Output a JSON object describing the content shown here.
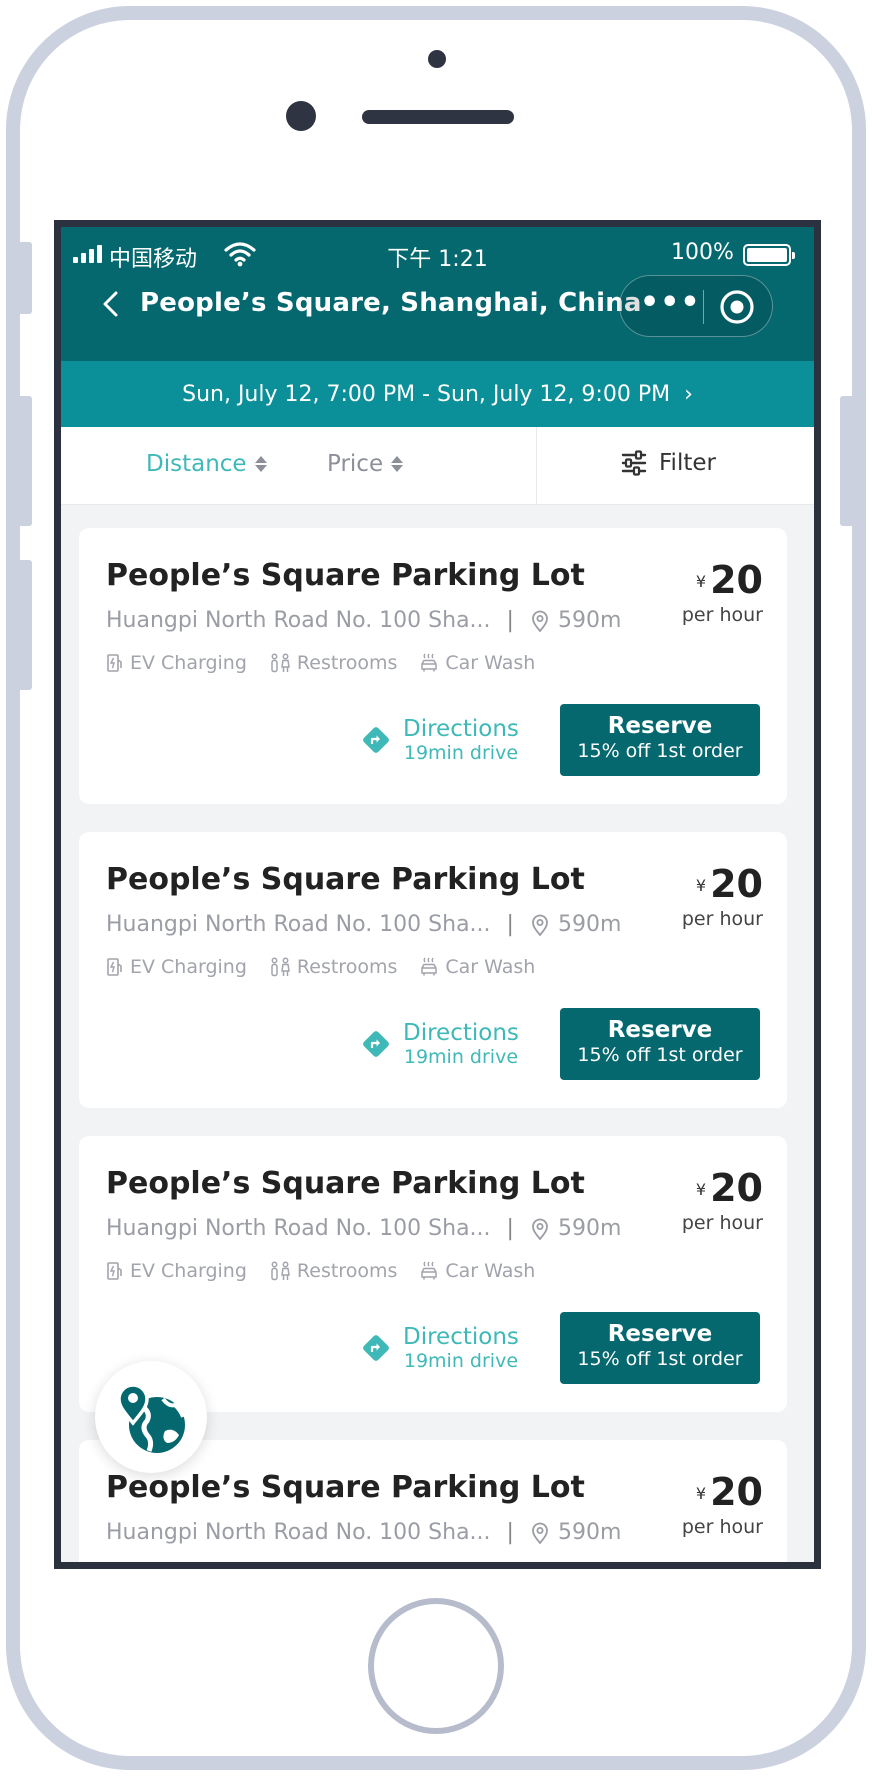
{
  "status_bar": {
    "carrier": "中国移动",
    "time": "下午 1:21",
    "battery": "100%"
  },
  "header": {
    "title": "People’s Square, Shanghai, China",
    "more_label": "•••"
  },
  "date_range": {
    "text": "Sun, July 12, 7:00 PM - Sun, July 12, 9:00 PM",
    "chevron": "›"
  },
  "sort": {
    "distance": "Distance",
    "price": "Price",
    "filter": "Filter",
    "active": "distance"
  },
  "lots": [
    {
      "name": "People’s Square Parking Lot",
      "address": "Huangpi North Road No. 100 Sha...",
      "distance": "590m",
      "amenities": [
        "EV Charging",
        "Restrooms",
        "Car Wash"
      ],
      "currency": "¥",
      "price": "20",
      "unit": "per hour",
      "directions": "Directions",
      "drive_time": "19min drive",
      "reserve": "Reserve",
      "promo": "15% off 1st order"
    },
    {
      "name": "People’s Square Parking Lot",
      "address": "Huangpi North Road No. 100 Sha...",
      "distance": "590m",
      "amenities": [
        "EV Charging",
        "Restrooms",
        "Car Wash"
      ],
      "currency": "¥",
      "price": "20",
      "unit": "per hour",
      "directions": "Directions",
      "drive_time": "19min drive",
      "reserve": "Reserve",
      "promo": "15% off 1st order"
    },
    {
      "name": "People’s Square Parking Lot",
      "address": "Huangpi North Road No. 100 Sha...",
      "distance": "590m",
      "amenities": [
        "EV Charging",
        "Restrooms",
        "Car Wash"
      ],
      "currency": "¥",
      "price": "20",
      "unit": "per hour",
      "directions": "Directions",
      "drive_time": "19min drive",
      "reserve": "Reserve",
      "promo": "15% off 1st order"
    },
    {
      "name": "People’s Square Parking Lot",
      "address": "Huangpi North Road No. 100 Sha...",
      "distance": "590m",
      "currency": "¥",
      "price": "20",
      "unit": "per hour"
    }
  ],
  "colors": {
    "primary": "#05686f",
    "date_bar": "#0b8f98",
    "accent": "#3fb8b8",
    "background": "#f2f3f5",
    "frame": "#ccd1df"
  },
  "icons": [
    "back-icon",
    "more-icon",
    "target-icon",
    "filter-icon",
    "location-pin-icon",
    "ev-charging-icon",
    "restroom-icon",
    "car-wash-icon",
    "directions-icon",
    "map-view-icon"
  ]
}
